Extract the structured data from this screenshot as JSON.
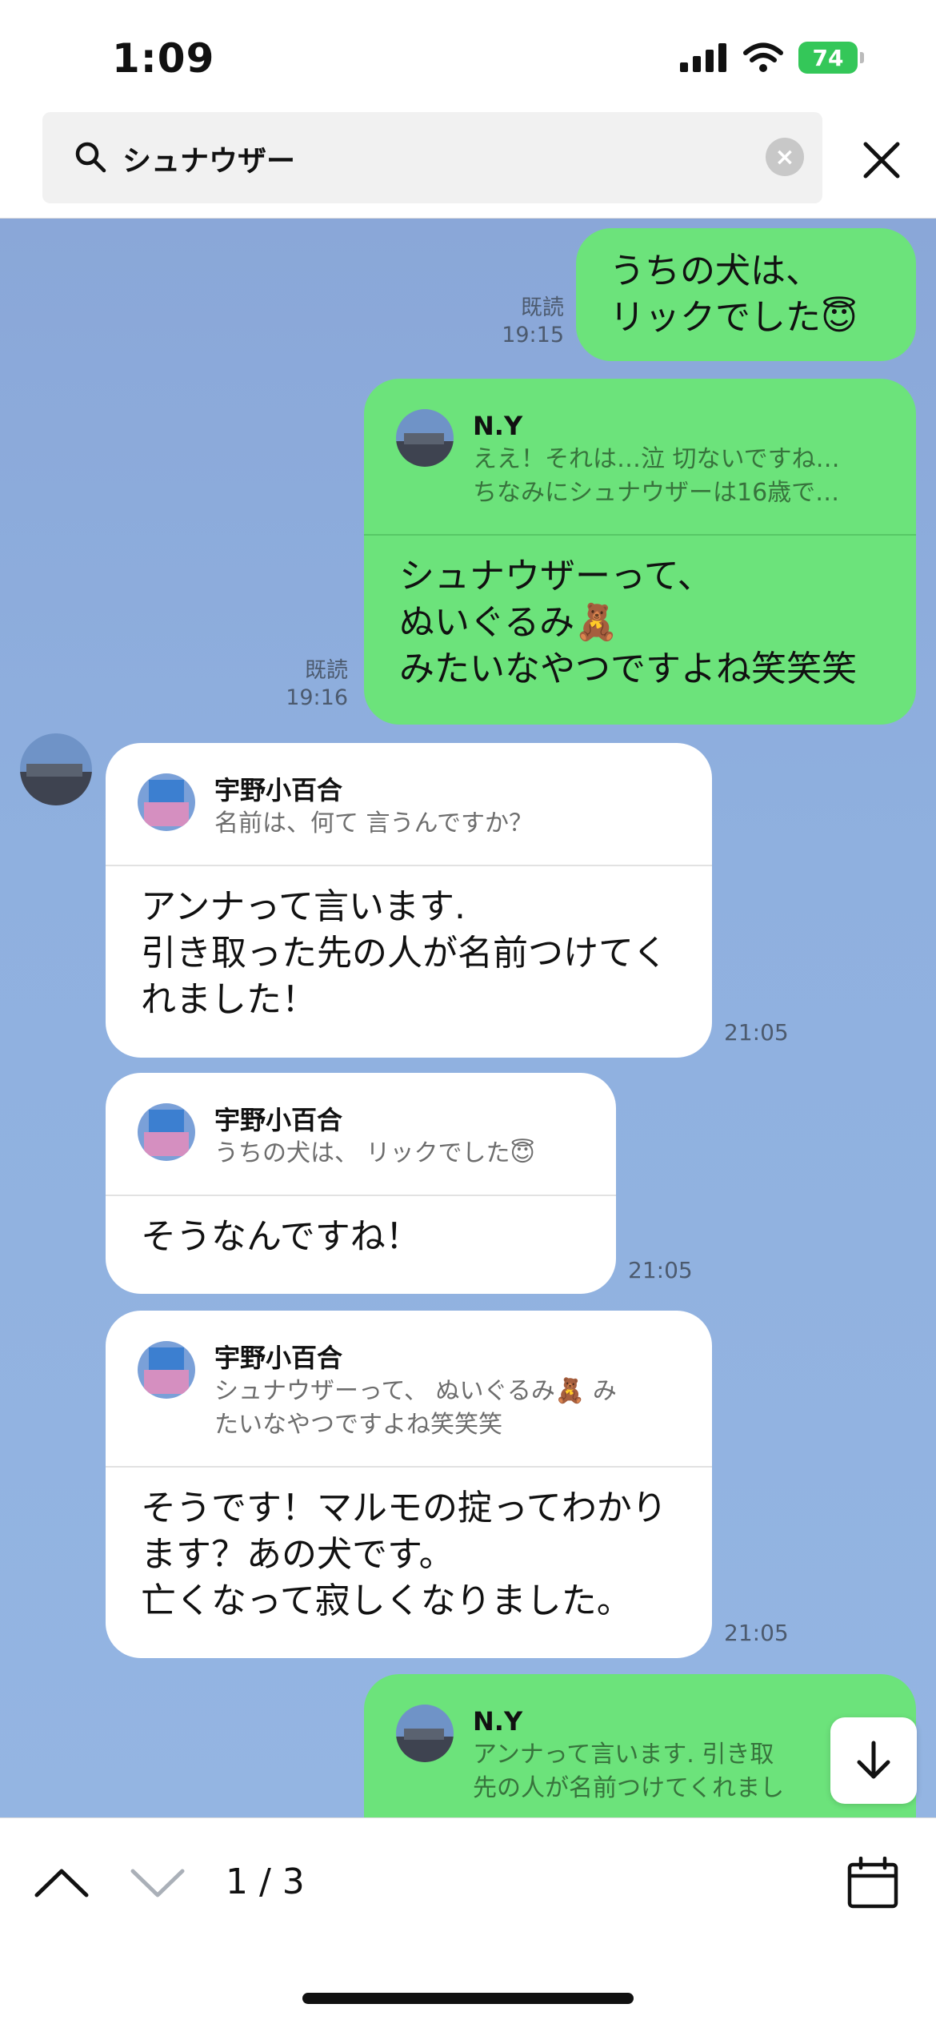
{
  "status": {
    "time": "1:09",
    "battery": "74"
  },
  "search": {
    "query": "シュナウザー"
  },
  "messages": {
    "m1": {
      "text_line1": "うちの犬は、",
      "text_line2": "リックでした😇",
      "read": "既読",
      "time": "19:15"
    },
    "m2": {
      "reply_name": "N.Y",
      "reply_quote": "ええ！それは…泣 切ないですね…\nちなみにシュナウザーは16歳で…",
      "body": "シュナウザーって、\nぬいぐるみ🧸\nみたいなやつですよね笑笑笑",
      "read": "既読",
      "time": "19:16"
    },
    "m3": {
      "reply_name": "宇野小百合",
      "reply_quote": "名前は、何て 言うんですか？",
      "body": "アンナって言います.\n引き取った先の人が名前つけてく\nれました！",
      "time": "21:05"
    },
    "m4": {
      "reply_name": "宇野小百合",
      "reply_quote": "うちの犬は、 リックでした😇",
      "body": "そうなんですね！",
      "time": "21:05"
    },
    "m5": {
      "reply_name": "宇野小百合",
      "reply_quote": "シュナウザーって、 ぬいぐるみ🧸 み\nたいなやつですよね笑笑笑",
      "body": "そうです！マルモの掟ってわかり\nます？あの犬です。\n亡くなって寂しくなりました。",
      "time": "21:05"
    },
    "m6": {
      "reply_name": "N.Y",
      "reply_quote": "アンナって言います. 引き取\n先の人が名前つけてくれまし"
    }
  },
  "bottom": {
    "counter": "1 / 3"
  },
  "colors": {
    "chat_bg": "#8fb0df",
    "outgoing": "#6ce37b",
    "incoming": "#ffffff",
    "battery": "#34c759"
  }
}
